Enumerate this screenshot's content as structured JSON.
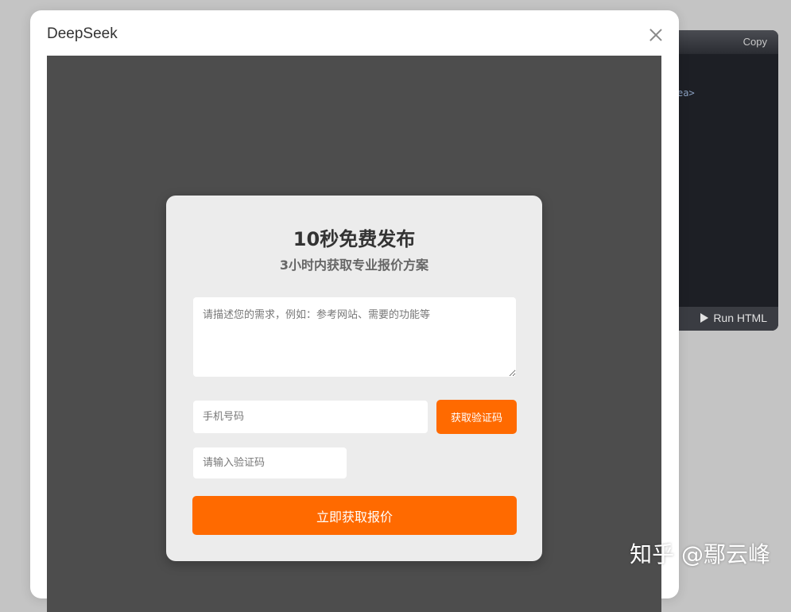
{
  "modal": {
    "title": "DeepSeek"
  },
  "code_panel": {
    "copy_label": "Copy",
    "code_fragment": "ea>",
    "run_label": "Run HTML"
  },
  "form": {
    "title": "10秒免费发布",
    "subtitle": "3小时内获取专业报价方案",
    "requirement_placeholder": "请描述您的需求，例如：参考网站、需要的功能等",
    "requirement_value": "",
    "phone_placeholder": "手机号码",
    "phone_value": "",
    "sms_button_label": "获取验证码",
    "code_placeholder": "请输入验证码",
    "code_value": "",
    "submit_label": "立即获取报价",
    "accent_color": "#ff6a00"
  },
  "watermark": "知乎 @鄢云峰"
}
